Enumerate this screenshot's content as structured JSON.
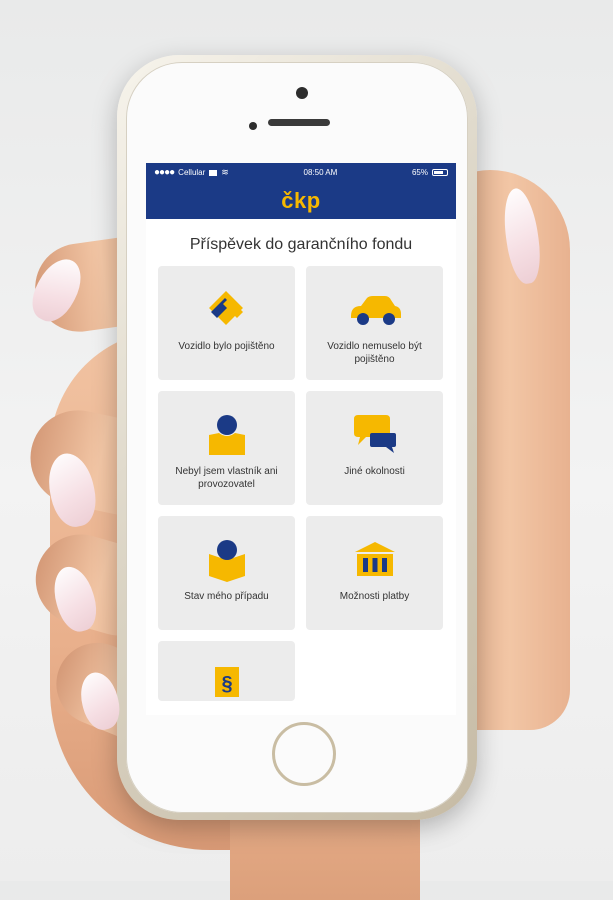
{
  "status_bar": {
    "carrier": "Cellular",
    "time": "08:50 AM",
    "battery": "65%"
  },
  "header": {
    "logo_text": "čkp"
  },
  "page": {
    "title": "Příspěvek do garančního fondu"
  },
  "tiles": [
    {
      "label": "Vozidlo bylo pojištěno",
      "icon": "handshake-icon"
    },
    {
      "label": "Vozidlo nemuselo být pojištěno",
      "icon": "car-icon"
    },
    {
      "label": "Nebyl jsem vlastník ani provozovatel",
      "icon": "person-icon"
    },
    {
      "label": "Jiné okolnosti",
      "icon": "chat-bubbles-icon"
    },
    {
      "label": "Stav mého případu",
      "icon": "open-book-icon"
    },
    {
      "label": "Možnosti platby",
      "icon": "bank-icon"
    },
    {
      "label": "",
      "icon": "paragraph-icon"
    }
  ],
  "colors": {
    "brand_blue": "#1b3a86",
    "brand_yellow": "#f6b800",
    "tile_bg": "#ececec"
  }
}
